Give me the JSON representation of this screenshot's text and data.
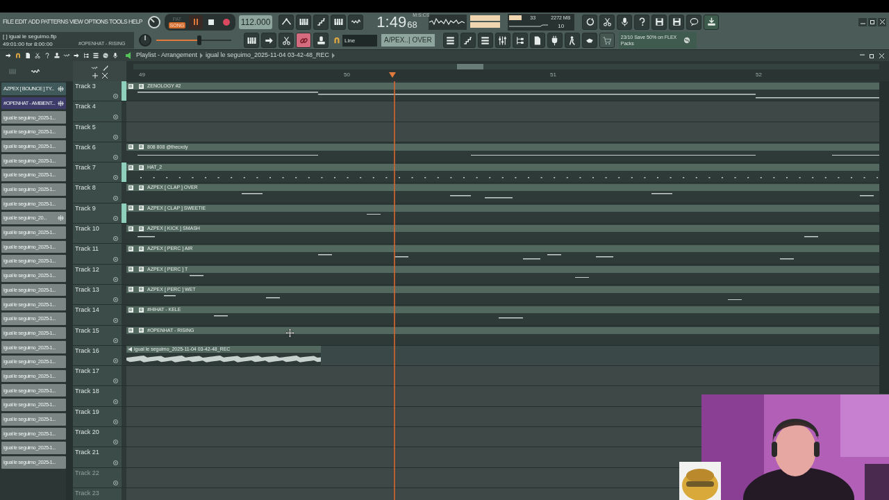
{
  "menu": [
    "FILE",
    "EDIT",
    "ADD",
    "PATTERNS",
    "VIEW",
    "OPTIONS",
    "TOOLS",
    "HELP"
  ],
  "mode_toggle": [
    {
      "label": "PAT",
      "selected": false
    },
    {
      "label": "SONG",
      "selected": true
    }
  ],
  "tempo": "112.000",
  "time": {
    "main": "1:49",
    "centis": "68",
    "unit": "M:S:CS"
  },
  "monitor": {
    "cpu": "33",
    "memory": "2272 MB",
    "polyphony": "10"
  },
  "hint": {
    "file": "[  ] igual le seguimo.flp",
    "position": "49:01:00 for 8:00:00",
    "pattern": "#OPENHAT - RISING"
  },
  "master_volume": {
    "level": 0.57
  },
  "snap": "Line",
  "pattern_selector": "A/PEX..| OVER",
  "news": "23/10 Save 50% on FLEX Packs",
  "playlist": {
    "title": "Playlist - Arrangement",
    "arrangement": "igual le seguimo_2025-11-04 03-42-48_REC",
    "ruler": [
      "49",
      "50",
      "51",
      "52"
    ]
  },
  "picker": [
    {
      "label": "AZPEX [ BOUNCE ] TY...",
      "color": "#40595b",
      "marked": true
    },
    {
      "label": "#OPENHAT - AMBIENT...",
      "color": "#3d3c6b",
      "marked": true
    },
    {
      "label": "igual le seguimo_2025-1...",
      "color": "#7b8685",
      "marked": false
    },
    {
      "label": "igual le seguimo_2025-1...",
      "color": "#7b8685",
      "marked": false
    },
    {
      "label": "igual le seguimo_2025-1...",
      "color": "#7b8685",
      "marked": false
    },
    {
      "label": "igual le seguimo_2025-1...",
      "color": "#7b8685",
      "marked": false
    },
    {
      "label": "igual le seguimo_2025-1...",
      "color": "#7b8685",
      "marked": false
    },
    {
      "label": "igual le seguimo_2025-1...",
      "color": "#7b8685",
      "marked": false
    },
    {
      "label": "igual le seguimo_2025-1...",
      "color": "#7b8685",
      "marked": false
    },
    {
      "label": "igual le seguimo_20...",
      "color": "#7b8685",
      "marked": true
    },
    {
      "label": "igual le seguimo_2025-1...",
      "color": "#7b8685",
      "marked": false
    },
    {
      "label": "igual le seguimo_2025-1...",
      "color": "#7b8685",
      "marked": false
    },
    {
      "label": "igual le seguimo_2025-1...",
      "color": "#7b8685",
      "marked": false
    },
    {
      "label": "igual le seguimo_2025-1...",
      "color": "#7b8685",
      "marked": false
    },
    {
      "label": "igual le seguimo_2025-1...",
      "color": "#7b8685",
      "marked": false
    },
    {
      "label": "igual le seguimo_2025-1...",
      "color": "#7b8685",
      "marked": false
    },
    {
      "label": "igual le seguimo_2025-1...",
      "color": "#7b8685",
      "marked": false
    },
    {
      "label": "igual le seguimo_2025-1...",
      "color": "#7b8685",
      "marked": false
    },
    {
      "label": "igual le seguimo_2025-1...",
      "color": "#7b8685",
      "marked": false
    },
    {
      "label": "igual le seguimo_2025-1...",
      "color": "#7b8685",
      "marked": false
    },
    {
      "label": "igual le seguimo_2025-1...",
      "color": "#7b8685",
      "marked": false
    },
    {
      "label": "igual le seguimo_2025-1...",
      "color": "#7b8685",
      "marked": false
    },
    {
      "label": "igual le seguimo_2025-1...",
      "color": "#7b8685",
      "marked": false
    },
    {
      "label": "igual le seguimo_2025-1...",
      "color": "#7b8685",
      "marked": false
    },
    {
      "label": "igual le seguimo_2025-1...",
      "color": "#7b8685",
      "marked": false
    },
    {
      "label": "igual le seguimo_2025-1...",
      "color": "#7b8685",
      "marked": false
    },
    {
      "label": "igual le seguimo_2025-1...",
      "color": "#7b8685",
      "marked": false
    }
  ],
  "tracks": [
    {
      "name": "Track 3",
      "highlighted": true,
      "dimmed": false,
      "clip": {
        "kind": "pattern",
        "name": "ZENOLOGY #2"
      }
    },
    {
      "name": "Track 4",
      "highlighted": false,
      "dimmed": false
    },
    {
      "name": "Track 5",
      "highlighted": false,
      "dimmed": false
    },
    {
      "name": "Track 6",
      "highlighted": false,
      "dimmed": false,
      "clip": {
        "kind": "pattern",
        "name": "808 808 @thecxdy"
      }
    },
    {
      "name": "Track 7",
      "highlighted": true,
      "dimmed": false,
      "clip": {
        "kind": "pattern",
        "name": "HAT_2"
      }
    },
    {
      "name": "Track 8",
      "highlighted": false,
      "dimmed": false,
      "clip": {
        "kind": "pattern",
        "name": "AZPEX [ CLAP ] OVER"
      }
    },
    {
      "name": "Track 9",
      "highlighted": true,
      "dimmed": false,
      "clip": {
        "kind": "pattern",
        "name": "AZPEX [ CLAP ] SWEETIE"
      }
    },
    {
      "name": "Track 10",
      "highlighted": false,
      "dimmed": false,
      "clip": {
        "kind": "pattern",
        "name": "AZPEX [ KICK ] SMASH"
      }
    },
    {
      "name": "Track 11",
      "highlighted": false,
      "dimmed": false,
      "clip": {
        "kind": "pattern",
        "name": "AZPEX [ PERC ] AIR"
      }
    },
    {
      "name": "Track 12",
      "highlighted": false,
      "dimmed": false,
      "clip": {
        "kind": "pattern",
        "name": "AZPEX [ PERC ] T"
      }
    },
    {
      "name": "Track 13",
      "highlighted": false,
      "dimmed": false,
      "clip": {
        "kind": "pattern",
        "name": "AZPEX [ PERC ] WET"
      }
    },
    {
      "name": "Track 14",
      "highlighted": false,
      "dimmed": false,
      "clip": {
        "kind": "pattern",
        "name": "#HIHAT - KELE"
      }
    },
    {
      "name": "Track 15",
      "highlighted": false,
      "dimmed": false,
      "clip": {
        "kind": "pattern",
        "name": "#OPENHAT - RISING"
      }
    },
    {
      "name": "Track 16",
      "highlighted": false,
      "dimmed": false,
      "clip": {
        "kind": "audio",
        "name": "igual le seguimo_2025-11-04 03-42-48_REC"
      }
    },
    {
      "name": "Track 17",
      "highlighted": false,
      "dimmed": false
    },
    {
      "name": "Track 18",
      "highlighted": false,
      "dimmed": false
    },
    {
      "name": "Track 19",
      "highlighted": false,
      "dimmed": false
    },
    {
      "name": "Track 20",
      "highlighted": false,
      "dimmed": false
    },
    {
      "name": "Track 21",
      "highlighted": false,
      "dimmed": false
    },
    {
      "name": "Track 22",
      "highlighted": false,
      "dimmed": true
    },
    {
      "name": "Track 23",
      "highlighted": false,
      "dimmed": true
    }
  ]
}
